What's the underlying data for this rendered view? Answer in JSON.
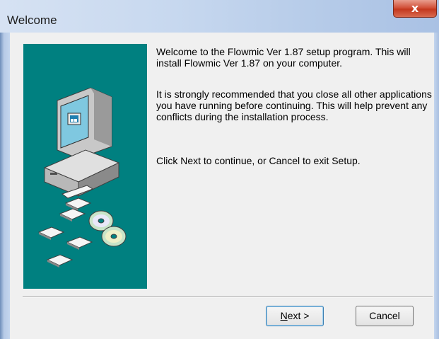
{
  "window": {
    "title": "Welcome",
    "close_symbol": "x"
  },
  "illustration": {
    "icon": "computer-with-disks-icon",
    "background_color": "#008080"
  },
  "message": {
    "line1": "Welcome to the Flowmic  Ver 1.87 setup program. This will install Flowmic  Ver 1.87 on your computer.",
    "line2": "It is strongly recommended that you close all other applications you have running before continuing. This will help prevent any conflicts during the installation process.",
    "line3": "Click Next to continue, or Cancel to exit Setup."
  },
  "buttons": {
    "next_mnemonic": "N",
    "next_rest": "ext >",
    "cancel_label": "Cancel"
  }
}
